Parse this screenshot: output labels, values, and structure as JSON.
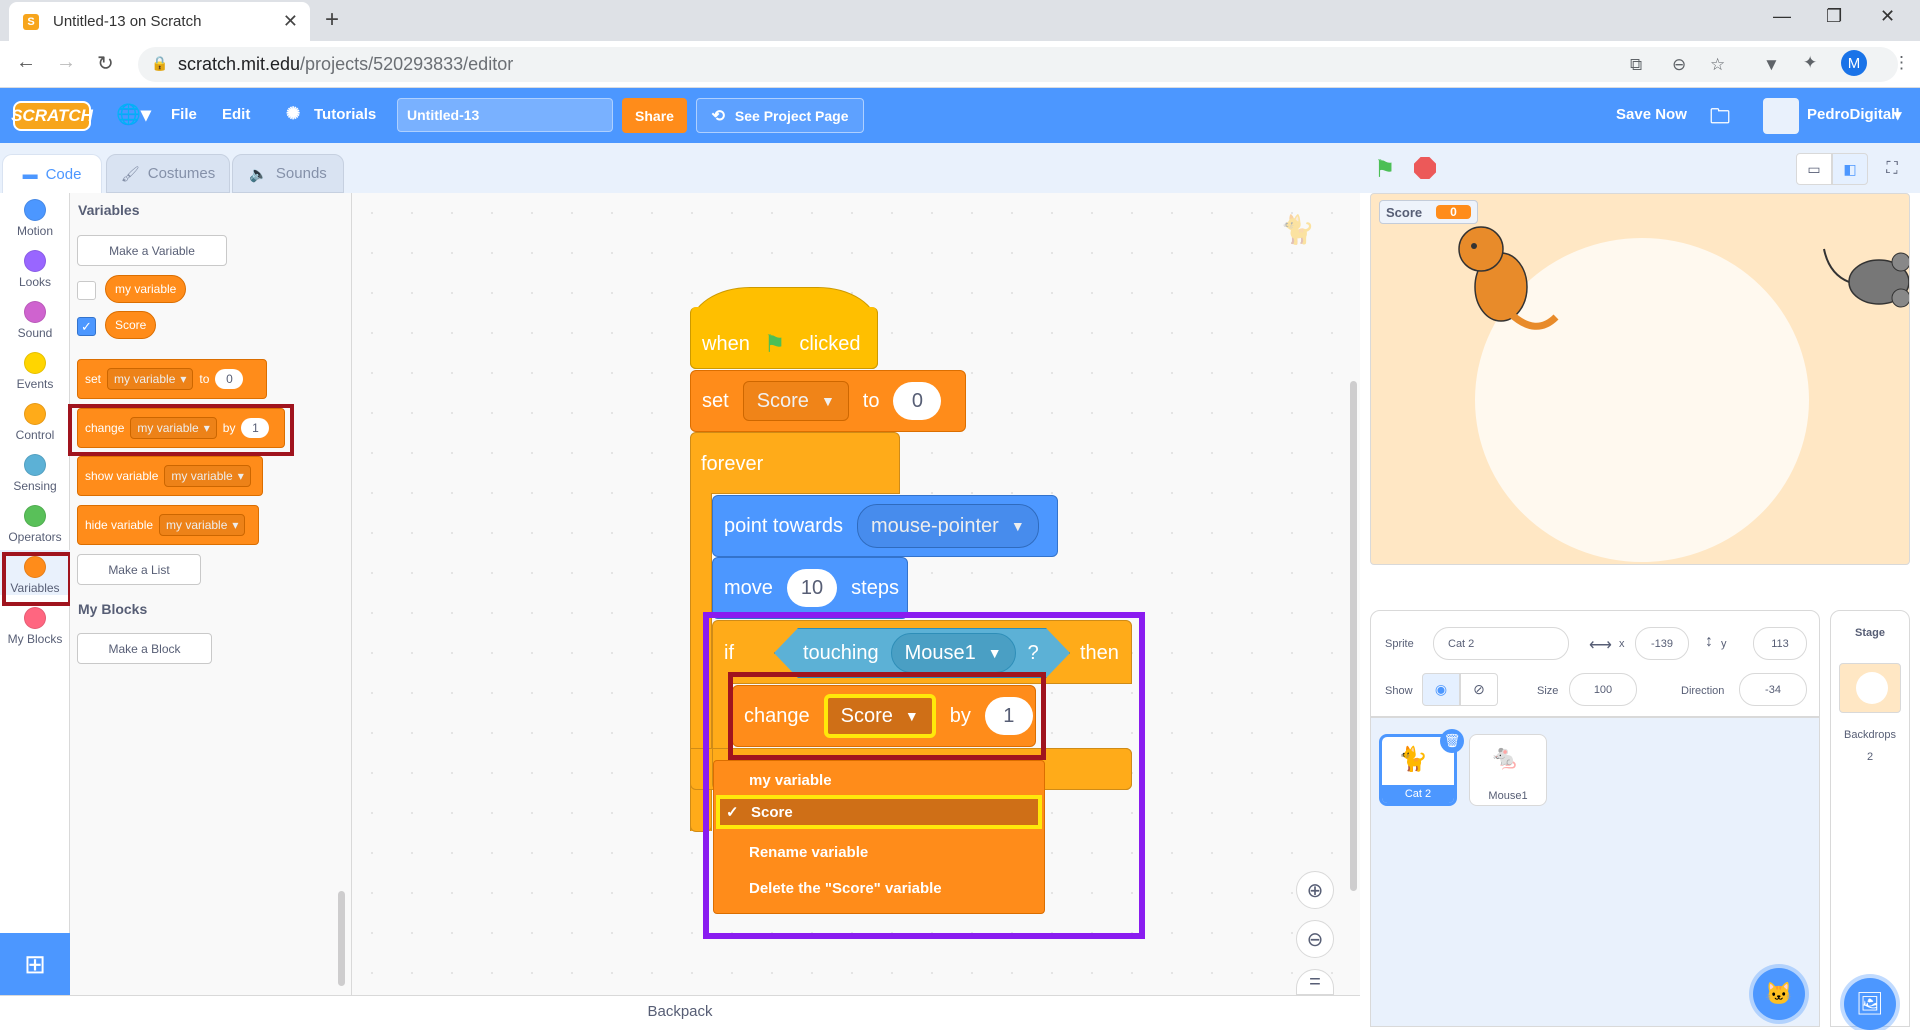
{
  "browser": {
    "tab_title": "Untitled-13 on Scratch",
    "url_host": "scratch.mit.edu",
    "url_path": "/projects/520293833/editor",
    "profile_initial": "M"
  },
  "menubar": {
    "logo": "SCRATCH",
    "file": "File",
    "edit": "Edit",
    "tutorials": "Tutorials",
    "project_title": "Untitled-13",
    "share": "Share",
    "see_project": "See Project Page",
    "save_now": "Save Now",
    "username": "PedroDigitall"
  },
  "editor_tabs": {
    "code": "Code",
    "costumes": "Costumes",
    "sounds": "Sounds"
  },
  "categories": [
    {
      "label": "Motion",
      "color": "#4c97ff"
    },
    {
      "label": "Looks",
      "color": "#9966ff"
    },
    {
      "label": "Sound",
      "color": "#cf63cf"
    },
    {
      "label": "Events",
      "color": "#ffd500"
    },
    {
      "label": "Control",
      "color": "#ffab19"
    },
    {
      "label": "Sensing",
      "color": "#5cb1d6"
    },
    {
      "label": "Operators",
      "color": "#59c059"
    },
    {
      "label": "Variables",
      "color": "#ff8c1a"
    },
    {
      "label": "My Blocks",
      "color": "#ff6680"
    }
  ],
  "palette": {
    "heading_variables": "Variables",
    "make_variable": "Make a Variable",
    "var1": "my variable",
    "var2": "Score",
    "set_label": "set",
    "set_var": "my variable",
    "set_to": "to",
    "set_val": "0",
    "change_label": "change",
    "change_var": "my variable",
    "change_by": "by",
    "change_val": "1",
    "show_label": "show variable",
    "show_var": "my variable",
    "hide_label": "hide variable",
    "hide_var": "my variable",
    "make_list": "Make a List",
    "heading_myblocks": "My Blocks",
    "make_block": "Make a Block"
  },
  "script": {
    "when": "when",
    "clicked": "clicked",
    "set": "set",
    "set_var": "Score",
    "set_to": "to",
    "set_val": "0",
    "forever": "forever",
    "point_towards": "point towards",
    "point_target": "mouse-pointer",
    "move": "move",
    "move_val": "10",
    "steps": "steps",
    "if": "if",
    "touching": "touching",
    "touching_target": "Mouse1",
    "question": "?",
    "then": "then",
    "change": "change",
    "change_var": "Score",
    "by": "by",
    "change_val": "1"
  },
  "dropdown": {
    "items": [
      "my variable",
      "Score",
      "Rename variable",
      "Delete the \"Score\" variable"
    ],
    "selected_index": 1,
    "check": "✓"
  },
  "backpack": "Backpack",
  "stage": {
    "monitor_label": "Score",
    "monitor_value": "0"
  },
  "sprite_info": {
    "sprite_label": "Sprite",
    "sprite_name": "Cat 2",
    "x_label": "x",
    "x_val": "-139",
    "y_label": "y",
    "y_val": "113",
    "show_label": "Show",
    "size_label": "Size",
    "size_val": "100",
    "direction_label": "Direction",
    "direction_val": "-34"
  },
  "sprites": [
    {
      "name": "Cat 2",
      "selected": true
    },
    {
      "name": "Mouse1",
      "selected": false
    }
  ],
  "stage_panel": {
    "title": "Stage",
    "backdrops_label": "Backdrops",
    "backdrops_count": "2"
  },
  "colors": {
    "highlight_red": "#a0141e",
    "highlight_yellow": "#ffe80a",
    "highlight_purple": "#8a1cf0"
  }
}
